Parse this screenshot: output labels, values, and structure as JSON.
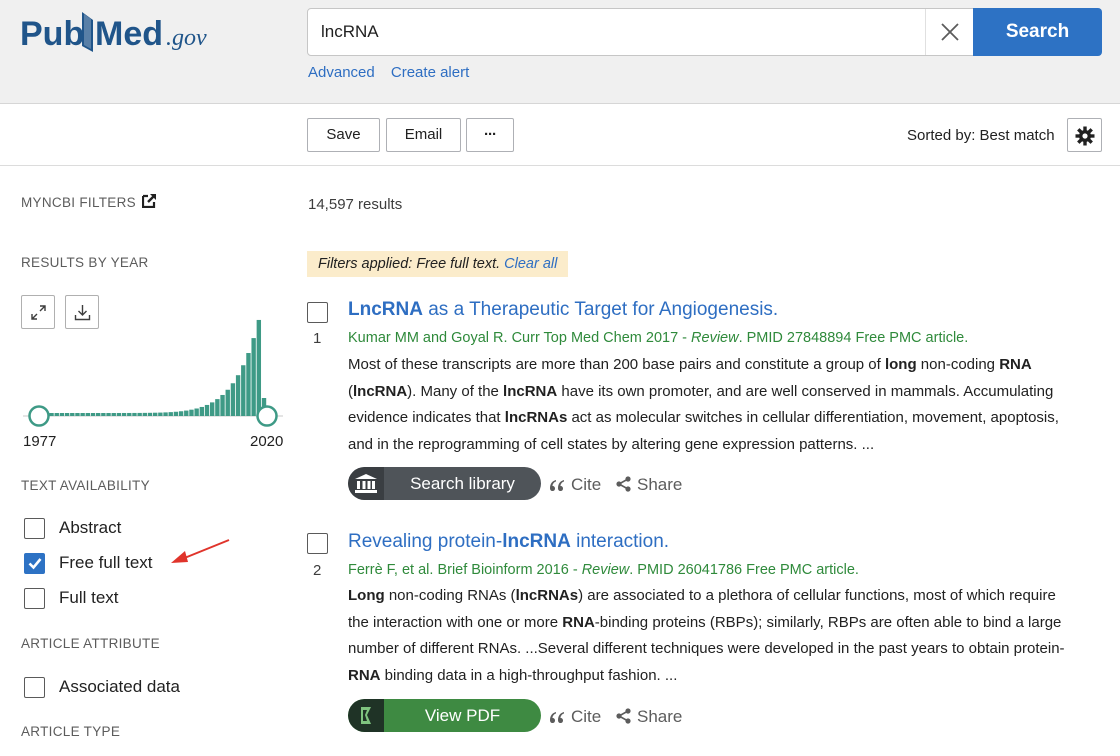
{
  "header": {
    "logo_text": "PubMed.gov",
    "search_value": "lncRNA",
    "search_button": "Search",
    "links": [
      "Advanced",
      "Create alert"
    ]
  },
  "toolbar": {
    "save": "Save",
    "email": "Email",
    "more": "···",
    "sorted_by": "Sorted by: Best match"
  },
  "sidebar": {
    "myncbi_filters": "MYNCBI FILTERS",
    "results_by_year": "RESULTS BY YEAR",
    "year_start": "1977",
    "year_end": "2020",
    "text_availability": "TEXT AVAILABILITY",
    "text_options": [
      {
        "label": "Abstract",
        "checked": false
      },
      {
        "label": "Free full text",
        "checked": true
      },
      {
        "label": "Full text",
        "checked": false
      }
    ],
    "article_attribute": "ARTICLE ATTRIBUTE",
    "attribute_options": [
      {
        "label": "Associated data",
        "checked": false
      }
    ],
    "article_type": "ARTICLE TYPE"
  },
  "results": {
    "count": "14,597 results",
    "filters_prefix": "Filters applied: Free full text.",
    "clear_all": "Clear all",
    "items": [
      {
        "num": "1",
        "title_bold": "LncRNA",
        "title_rest": " as a Therapeutic Target for Angiogenesis.",
        "cite_pre": "Kumar MM and Goyal R. Curr Top Med Chem 2017 - ",
        "cite_type": "Review",
        "cite_post": ". PMID 27848894 Free PMC article.",
        "action_label": "Search library",
        "cite": "Cite",
        "share": "Share"
      },
      {
        "num": "2",
        "title_pre": "Revealing protein-",
        "title_bold": "lncRNA",
        "title_rest": " interaction.",
        "cite_pre": "Ferrè F, et al. Brief Bioinform 2016 - ",
        "cite_type": "Review",
        "cite_post": ". PMID 26041786 Free PMC article.",
        "action_label": "View PDF",
        "cite": "Cite",
        "share": "Share"
      }
    ]
  },
  "colors": {
    "accent": "#2d72c4",
    "link": "#2e6ec2",
    "citation": "#2f8a3b",
    "histogram": "#3e9a86",
    "search_library_pill": "#4f5459",
    "pdf_pill": "#3e8a42"
  }
}
